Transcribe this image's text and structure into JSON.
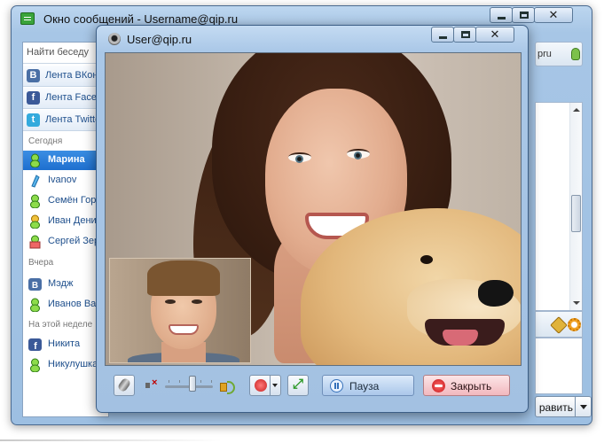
{
  "main_window": {
    "title": "Окно сообщений - Username@qip.ru",
    "search_placeholder": "Найти беседу",
    "feeds": [
      {
        "icon": "vkontakte-icon",
        "label": "Лента ВКон",
        "color": "#4a6fa5",
        "glyph": "B"
      },
      {
        "icon": "facebook-icon",
        "label": "Лента Face",
        "color": "#3b5998",
        "glyph": "f"
      },
      {
        "icon": "twitter-icon",
        "label": "Лента Twitte",
        "color": "#33aadd",
        "glyph": "t"
      }
    ],
    "sections": {
      "today": "Сегодня",
      "yesterday": "Вчера",
      "this_week": "На этой неделе"
    },
    "contacts": [
      {
        "label": "Марина",
        "icon": "qip-status-icon",
        "selected": true
      },
      {
        "label": "Ivanov",
        "icon": "icq-status-icon"
      },
      {
        "label": "Семён Гор",
        "icon": "qip-status-icon"
      },
      {
        "label": "Иван Денис",
        "icon": "qip-status-icon"
      },
      {
        "label": "Сергей Зер",
        "icon": "qip-status-icon"
      },
      {
        "label": "Мэдж",
        "icon": "vkontakte-icon"
      },
      {
        "label": "Иванов Вас",
        "icon": "qip-status-icon"
      },
      {
        "label": "Никита",
        "icon": "facebook-icon"
      },
      {
        "label": "Никулушка",
        "icon": "qip-status-icon"
      }
    ],
    "top_right_text": "pru",
    "send_label": "равить"
  },
  "video_window": {
    "title": "User@qip.ru",
    "volume_level": 0.58,
    "pause_label": "Пауза",
    "close_label": "Закрыть"
  },
  "colors": {
    "accent": "#1e6fcf",
    "window_frame": "#a9c7e7",
    "close_button": "#f2b8be",
    "pause_button": "#aac7ea"
  }
}
